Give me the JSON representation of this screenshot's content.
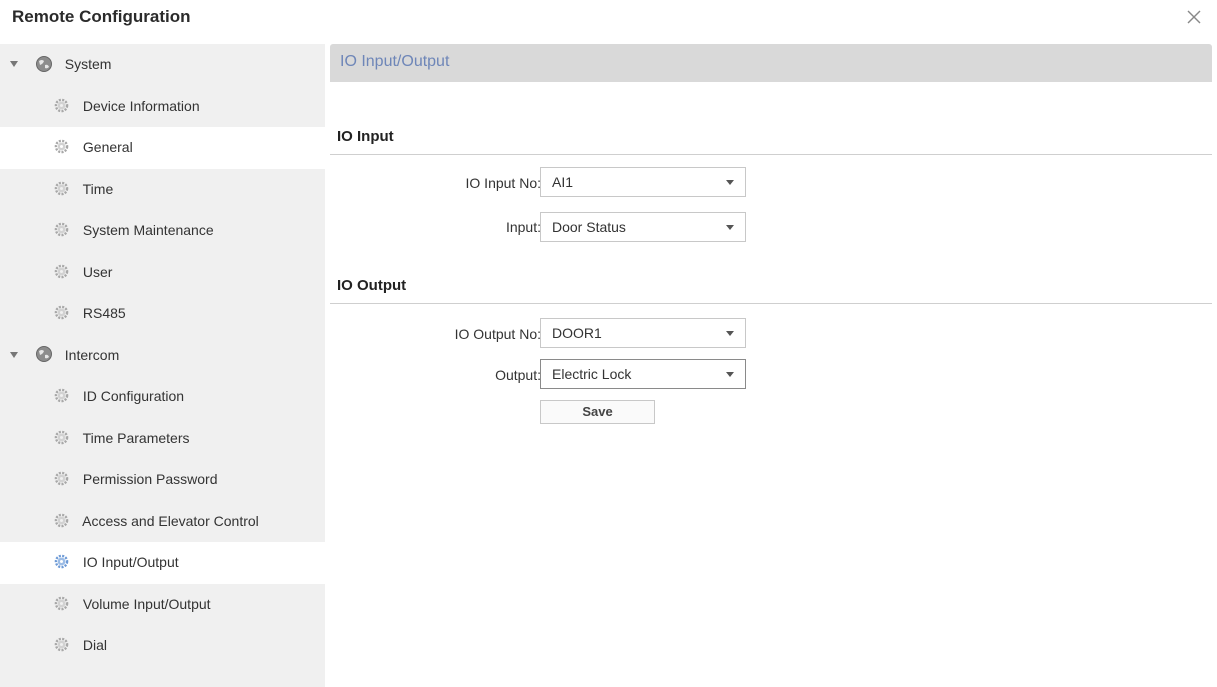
{
  "window": {
    "title": "Remote Configuration",
    "close_icon": "close-icon"
  },
  "sidebar": {
    "groups": [
      {
        "label": "System",
        "icon": "globe-icon",
        "expanded": true,
        "items": [
          {
            "label": "Device Information"
          },
          {
            "label": "General",
            "selected": true
          },
          {
            "label": "Time"
          },
          {
            "label": "System Maintenance"
          },
          {
            "label": "User"
          },
          {
            "label": "RS485"
          }
        ]
      },
      {
        "label": "Intercom",
        "icon": "globe-icon",
        "expanded": true,
        "items": [
          {
            "label": "ID Configuration"
          },
          {
            "label": "Time Parameters"
          },
          {
            "label": "Permission Password"
          },
          {
            "label": "Access and Elevator Control"
          },
          {
            "label": "IO Input/Output",
            "selected": true,
            "active_icon": true
          },
          {
            "label": "Volume Input/Output"
          },
          {
            "label": "Dial"
          }
        ]
      }
    ]
  },
  "main": {
    "header_title": "IO Input/Output",
    "io_input": {
      "section_title": "IO Input",
      "input_no_label": "IO Input No:",
      "input_no_value": "AI1",
      "input_label": "Input:",
      "input_value": "Door Status"
    },
    "io_output": {
      "section_title": "IO Output",
      "output_no_label": "IO Output No:",
      "output_no_value": "DOOR1",
      "output_label": "Output:",
      "output_value": "Electric Lock"
    },
    "save_label": "Save"
  },
  "colors": {
    "header_title": "#6e86b8",
    "sidebar_bg": "#f0f0f0",
    "header_bg": "#d9d9d9",
    "active_gear": "#6d9ad6"
  }
}
